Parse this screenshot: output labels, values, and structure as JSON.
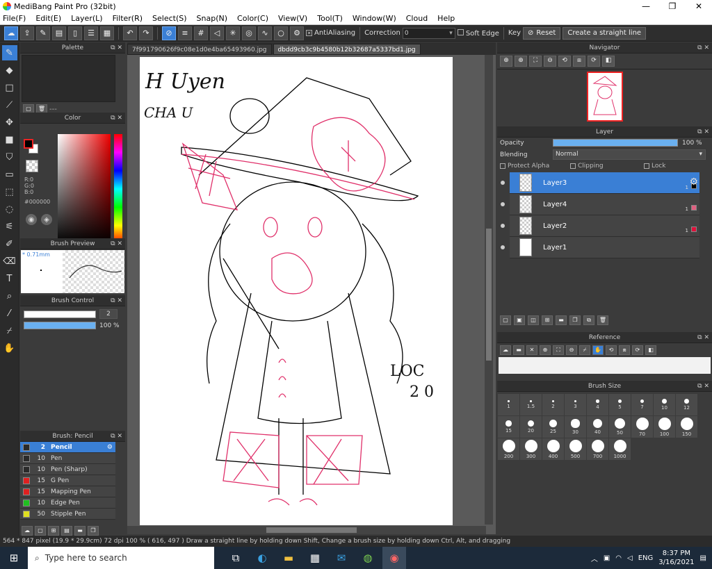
{
  "title": {
    "text": "MediBang Paint Pro (32bit)",
    "minimize": "—",
    "maximize": "❐",
    "close": "✕"
  },
  "menu": [
    "File(F)",
    "Edit(E)",
    "Layer(L)",
    "Filter(R)",
    "Select(S)",
    "Snap(N)",
    "Color(C)",
    "View(V)",
    "Tool(T)",
    "Window(W)",
    "Cloud",
    "Help"
  ],
  "toolbar": {
    "antialiasing": "AntiAliasing",
    "correction_label": "Correction",
    "correction_value": "0",
    "soft_edge": "Soft Edge",
    "key": "Key",
    "reset": "Reset",
    "straight_line": "Create a straight line"
  },
  "palette": {
    "title": "Palette",
    "dash": "---"
  },
  "color": {
    "title": "Color",
    "r": "R:0",
    "g": "G:0",
    "b": "B:0",
    "hex": "#000000",
    "fg": "#000000",
    "bg": "#ffffff"
  },
  "brush_preview": {
    "title": "Brush Preview",
    "size": "* 0.71mm"
  },
  "brush_control": {
    "title": "Brush Control",
    "size": "2",
    "opacity": "100 %"
  },
  "brush_list": {
    "title": "Brush: Pencil",
    "items": [
      {
        "size": "2",
        "name": "Pencil",
        "color": "#2a2a2a"
      },
      {
        "size": "10",
        "name": "Pen",
        "color": "#2a2a2a"
      },
      {
        "size": "10",
        "name": "Pen (Sharp)",
        "color": "#2a2a2a"
      },
      {
        "size": "15",
        "name": "G Pen",
        "color": "#e02020"
      },
      {
        "size": "15",
        "name": "Mapping Pen",
        "color": "#e02020"
      },
      {
        "size": "10",
        "name": "Edge Pen",
        "color": "#20c020"
      },
      {
        "size": "50",
        "name": "Stipple Pen",
        "color": "#e0e020"
      }
    ]
  },
  "tabs": [
    "7f991790626f9c08e1d0e4ba65493960.jpg",
    "dbdd9cb3c9b4580b12b32687a5337bd1.jpg"
  ],
  "canvas": {
    "text1": "H Uyen",
    "text2": "CHA U",
    "text3": "LOC",
    "text4": "2 0"
  },
  "navigator": {
    "title": "Navigator"
  },
  "layer": {
    "title": "Layer",
    "opacity_label": "Opacity",
    "opacity_value": "100 %",
    "blending_label": "Blending",
    "blending_value": "Normal",
    "protect_alpha": "Protect Alpha",
    "clipping": "Clipping",
    "lock": "Lock",
    "items": [
      {
        "name": "Layer3",
        "num": "1",
        "mark": "#000000"
      },
      {
        "name": "Layer4",
        "num": "1",
        "mark": "#e06080"
      },
      {
        "name": "Layer2",
        "num": "1",
        "mark": "#e0103a"
      },
      {
        "name": "Layer1",
        "num": "",
        "mark": ""
      }
    ]
  },
  "reference": {
    "title": "Reference"
  },
  "brush_size": {
    "title": "Brush Size",
    "sizes": [
      "1",
      "1.5",
      "2",
      "3",
      "4",
      "5",
      "7",
      "10",
      "12",
      "15",
      "20",
      "25",
      "30",
      "40",
      "50",
      "70",
      "100",
      "150",
      "200",
      "300",
      "400",
      "500",
      "700",
      "1000"
    ]
  },
  "status": "564 * 847 pixel   (19.9 * 29.9cm)   72 dpi   100 %   ( 616, 497 )   Draw a straight line by holding down Shift, Change a brush size by holding down Ctrl, Alt, and dragging",
  "taskbar": {
    "search": "Type here to search",
    "lang": "ENG",
    "time": "8:37 PM",
    "date": "3/16/2021"
  }
}
